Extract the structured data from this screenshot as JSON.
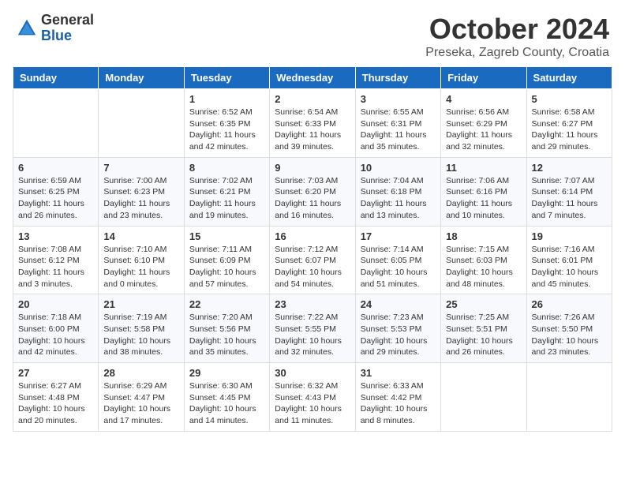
{
  "header": {
    "logo_general": "General",
    "logo_blue": "Blue",
    "month_title": "October 2024",
    "location": "Preseka, Zagreb County, Croatia"
  },
  "days_of_week": [
    "Sunday",
    "Monday",
    "Tuesday",
    "Wednesday",
    "Thursday",
    "Friday",
    "Saturday"
  ],
  "weeks": [
    [
      {
        "day": "",
        "info": ""
      },
      {
        "day": "",
        "info": ""
      },
      {
        "day": "1",
        "info": "Sunrise: 6:52 AM\nSunset: 6:35 PM\nDaylight: 11 hours and 42 minutes."
      },
      {
        "day": "2",
        "info": "Sunrise: 6:54 AM\nSunset: 6:33 PM\nDaylight: 11 hours and 39 minutes."
      },
      {
        "day": "3",
        "info": "Sunrise: 6:55 AM\nSunset: 6:31 PM\nDaylight: 11 hours and 35 minutes."
      },
      {
        "day": "4",
        "info": "Sunrise: 6:56 AM\nSunset: 6:29 PM\nDaylight: 11 hours and 32 minutes."
      },
      {
        "day": "5",
        "info": "Sunrise: 6:58 AM\nSunset: 6:27 PM\nDaylight: 11 hours and 29 minutes."
      }
    ],
    [
      {
        "day": "6",
        "info": "Sunrise: 6:59 AM\nSunset: 6:25 PM\nDaylight: 11 hours and 26 minutes."
      },
      {
        "day": "7",
        "info": "Sunrise: 7:00 AM\nSunset: 6:23 PM\nDaylight: 11 hours and 23 minutes."
      },
      {
        "day": "8",
        "info": "Sunrise: 7:02 AM\nSunset: 6:21 PM\nDaylight: 11 hours and 19 minutes."
      },
      {
        "day": "9",
        "info": "Sunrise: 7:03 AM\nSunset: 6:20 PM\nDaylight: 11 hours and 16 minutes."
      },
      {
        "day": "10",
        "info": "Sunrise: 7:04 AM\nSunset: 6:18 PM\nDaylight: 11 hours and 13 minutes."
      },
      {
        "day": "11",
        "info": "Sunrise: 7:06 AM\nSunset: 6:16 PM\nDaylight: 11 hours and 10 minutes."
      },
      {
        "day": "12",
        "info": "Sunrise: 7:07 AM\nSunset: 6:14 PM\nDaylight: 11 hours and 7 minutes."
      }
    ],
    [
      {
        "day": "13",
        "info": "Sunrise: 7:08 AM\nSunset: 6:12 PM\nDaylight: 11 hours and 3 minutes."
      },
      {
        "day": "14",
        "info": "Sunrise: 7:10 AM\nSunset: 6:10 PM\nDaylight: 11 hours and 0 minutes."
      },
      {
        "day": "15",
        "info": "Sunrise: 7:11 AM\nSunset: 6:09 PM\nDaylight: 10 hours and 57 minutes."
      },
      {
        "day": "16",
        "info": "Sunrise: 7:12 AM\nSunset: 6:07 PM\nDaylight: 10 hours and 54 minutes."
      },
      {
        "day": "17",
        "info": "Sunrise: 7:14 AM\nSunset: 6:05 PM\nDaylight: 10 hours and 51 minutes."
      },
      {
        "day": "18",
        "info": "Sunrise: 7:15 AM\nSunset: 6:03 PM\nDaylight: 10 hours and 48 minutes."
      },
      {
        "day": "19",
        "info": "Sunrise: 7:16 AM\nSunset: 6:01 PM\nDaylight: 10 hours and 45 minutes."
      }
    ],
    [
      {
        "day": "20",
        "info": "Sunrise: 7:18 AM\nSunset: 6:00 PM\nDaylight: 10 hours and 42 minutes."
      },
      {
        "day": "21",
        "info": "Sunrise: 7:19 AM\nSunset: 5:58 PM\nDaylight: 10 hours and 38 minutes."
      },
      {
        "day": "22",
        "info": "Sunrise: 7:20 AM\nSunset: 5:56 PM\nDaylight: 10 hours and 35 minutes."
      },
      {
        "day": "23",
        "info": "Sunrise: 7:22 AM\nSunset: 5:55 PM\nDaylight: 10 hours and 32 minutes."
      },
      {
        "day": "24",
        "info": "Sunrise: 7:23 AM\nSunset: 5:53 PM\nDaylight: 10 hours and 29 minutes."
      },
      {
        "day": "25",
        "info": "Sunrise: 7:25 AM\nSunset: 5:51 PM\nDaylight: 10 hours and 26 minutes."
      },
      {
        "day": "26",
        "info": "Sunrise: 7:26 AM\nSunset: 5:50 PM\nDaylight: 10 hours and 23 minutes."
      }
    ],
    [
      {
        "day": "27",
        "info": "Sunrise: 6:27 AM\nSunset: 4:48 PM\nDaylight: 10 hours and 20 minutes."
      },
      {
        "day": "28",
        "info": "Sunrise: 6:29 AM\nSunset: 4:47 PM\nDaylight: 10 hours and 17 minutes."
      },
      {
        "day": "29",
        "info": "Sunrise: 6:30 AM\nSunset: 4:45 PM\nDaylight: 10 hours and 14 minutes."
      },
      {
        "day": "30",
        "info": "Sunrise: 6:32 AM\nSunset: 4:43 PM\nDaylight: 10 hours and 11 minutes."
      },
      {
        "day": "31",
        "info": "Sunrise: 6:33 AM\nSunset: 4:42 PM\nDaylight: 10 hours and 8 minutes."
      },
      {
        "day": "",
        "info": ""
      },
      {
        "day": "",
        "info": ""
      }
    ]
  ]
}
